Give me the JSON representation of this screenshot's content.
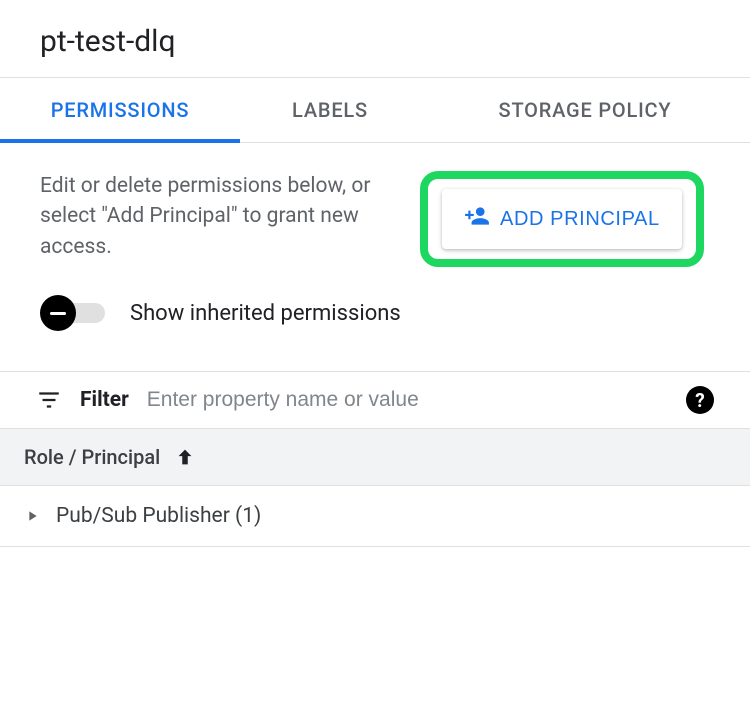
{
  "page_title": "pt-test-dlq",
  "tabs": [
    {
      "label": "PERMISSIONS",
      "active": true
    },
    {
      "label": "LABELS",
      "active": false
    },
    {
      "label": "STORAGE POLICY",
      "active": false
    }
  ],
  "permissions": {
    "help_text": "Edit or delete permissions below, or select \"Add Principal\" to grant new access.",
    "add_principal_label": "ADD PRINCIPAL",
    "toggle_label": "Show inherited permissions",
    "toggle_on": false
  },
  "filter": {
    "label": "Filter",
    "placeholder": "Enter property name or value"
  },
  "table": {
    "column_header": "Role / Principal",
    "sort_direction": "asc",
    "rows": [
      {
        "label": "Pub/Sub Publisher (1)"
      }
    ]
  }
}
